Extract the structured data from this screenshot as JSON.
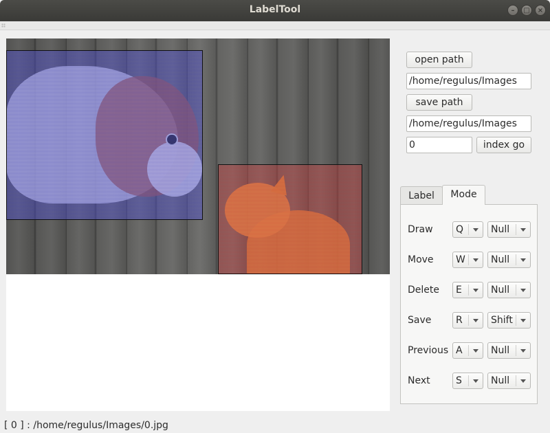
{
  "window": {
    "title": "LabelTool"
  },
  "controls": {
    "open_path_label": "open path",
    "open_path_value": "/home/regulus/Images",
    "save_path_label": "save path",
    "save_path_value": "/home/regulus/Images",
    "index_value": "0",
    "index_go_label": "index go"
  },
  "tabs": [
    {
      "label": "Label",
      "active": false
    },
    {
      "label": "Mode",
      "active": true
    }
  ],
  "mode_rows": [
    {
      "action": "Draw",
      "key": "Q",
      "modifier": "Null"
    },
    {
      "action": "Move",
      "key": "W",
      "modifier": "Null"
    },
    {
      "action": "Delete",
      "key": "E",
      "modifier": "Null"
    },
    {
      "action": "Save",
      "key": "R",
      "modifier": "Shift"
    },
    {
      "action": "Previous",
      "key": "A",
      "modifier": "Null"
    },
    {
      "action": "Next",
      "key": "S",
      "modifier": "Null"
    }
  ],
  "status": {
    "text": "[ 0 ] : /home/regulus/Images/0.jpg"
  },
  "annotations": [
    {
      "label_color": "#5a5adc",
      "subject": "dog"
    },
    {
      "label_color": "#c84f4f",
      "subject": "cat"
    }
  ]
}
